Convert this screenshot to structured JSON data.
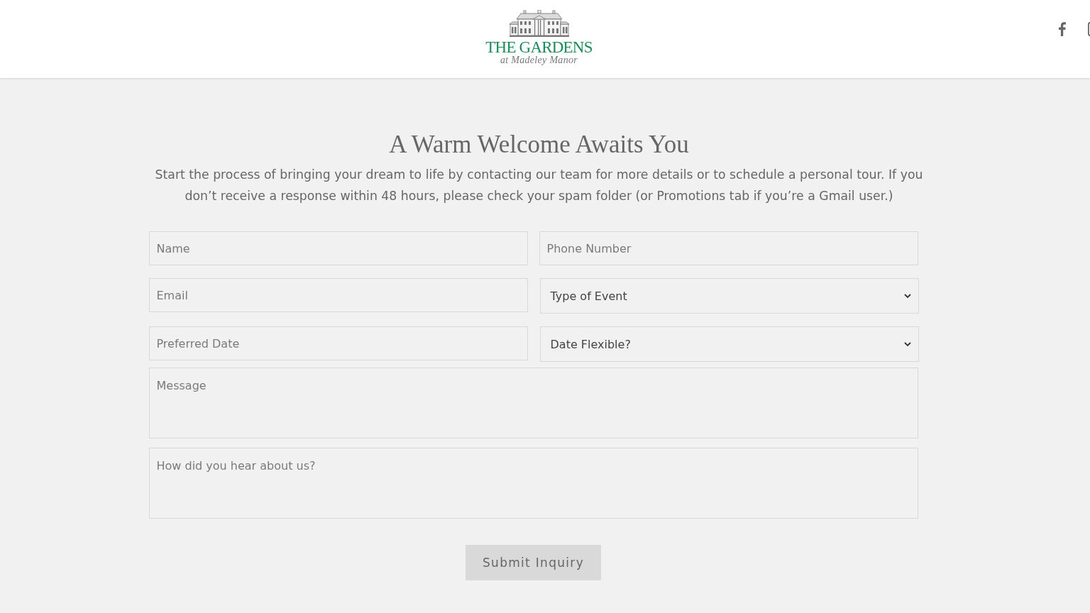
{
  "header": {
    "logo": {
      "title": "THE GARDENS",
      "subtitle": "at Madeley Manor"
    }
  },
  "intro": {
    "heading": "A Warm Welcome Awaits You",
    "text": "Start the process of bringing your dream to life by contacting our team for more details or to schedule a personal tour. If you don’t receive a response within 48 hours, please check your spam folder (or Promotions tab if you’re a Gmail user.)"
  },
  "form": {
    "fields": [
      {
        "kind": "input",
        "placeholder": "Name"
      },
      {
        "kind": "input",
        "placeholder": "Phone Number"
      },
      {
        "kind": "input",
        "placeholder": "Email"
      },
      {
        "kind": "select",
        "value": "Type of Event"
      },
      {
        "kind": "input",
        "placeholder": "Preferred Date"
      },
      {
        "kind": "select",
        "value": "Date Flexible?"
      },
      {
        "kind": "textarea",
        "placeholder": "Message"
      },
      {
        "kind": "textarea",
        "placeholder": "How did you hear about us?"
      }
    ],
    "submit": "Submit Inquiry"
  }
}
